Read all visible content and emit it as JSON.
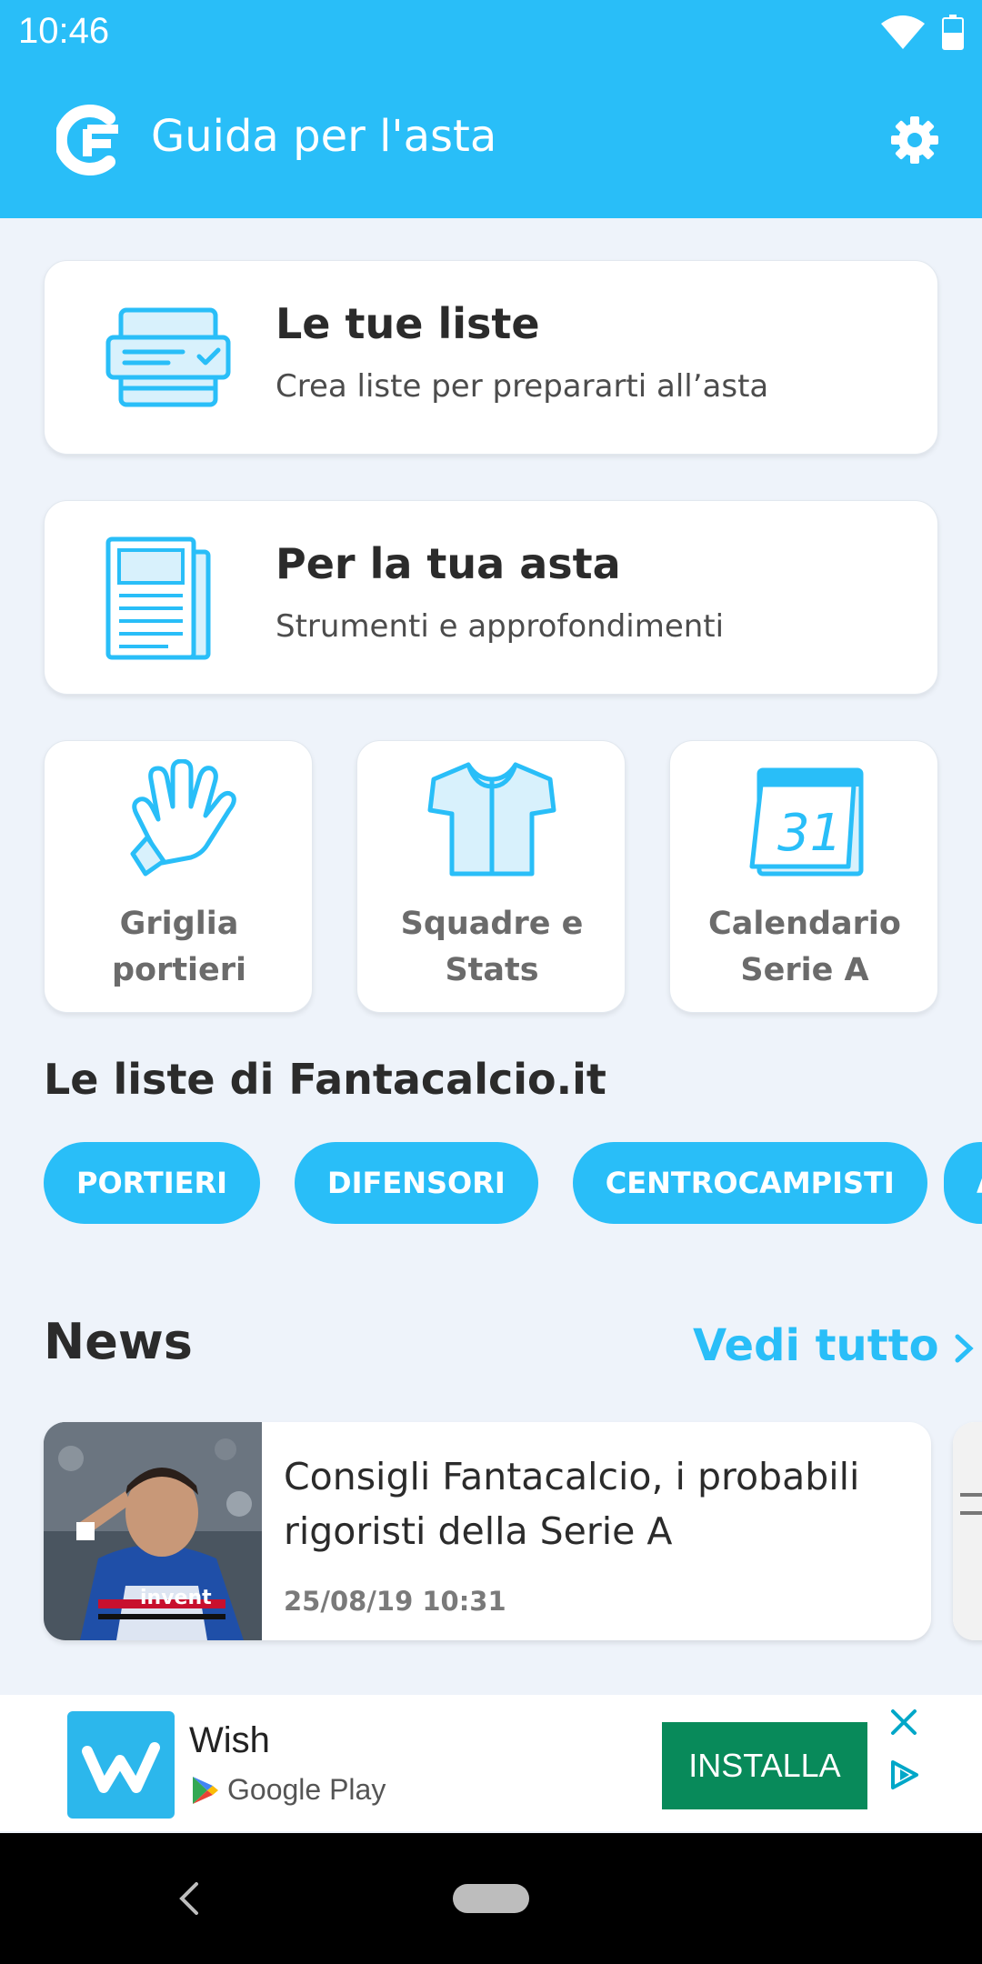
{
  "status": {
    "time": "10:46"
  },
  "appbar": {
    "title": "Guida per l'asta"
  },
  "cards": [
    {
      "title": "Le tue liste",
      "subtitle": "Crea liste per prepararti all’asta"
    },
    {
      "title": "Per la tua asta",
      "subtitle": "Strumenti e approfondimenti"
    }
  ],
  "tiles": [
    {
      "line1": "Griglia",
      "line2": "portieri"
    },
    {
      "line1": "Squadre e",
      "line2": "Stats"
    },
    {
      "line1": "Calendario",
      "line2": "Serie A"
    }
  ],
  "lists_section": {
    "title": "Le liste di Fantacalcio.it",
    "chips": [
      "PORTIERI",
      "DIFENSORI",
      "CENTROCAMPISTI",
      "A"
    ]
  },
  "news": {
    "title": "News",
    "see_all": "Vedi tutto",
    "items": [
      {
        "headline": "Consigli Fantacalcio, i probabili rigoristi della Serie A",
        "date": "25/08/19 10:31"
      }
    ]
  },
  "ad": {
    "app_name": "Wish",
    "store": "Google Play",
    "cta": "INSTALLA"
  },
  "colors": {
    "accent": "#29bef8",
    "install": "#088a5a",
    "background": "#eef3fa"
  }
}
